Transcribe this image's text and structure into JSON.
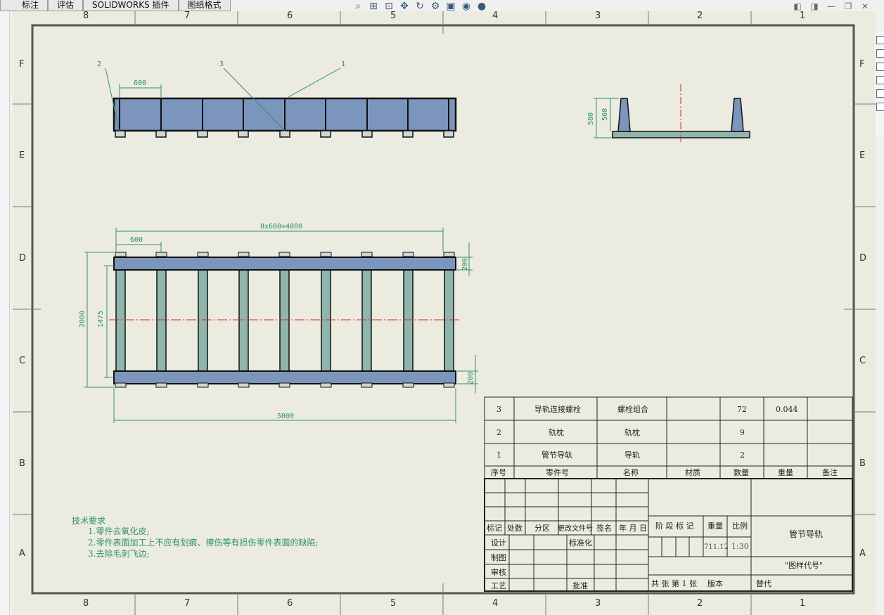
{
  "tabs": [
    "标注",
    "评估",
    "SOLIDWORKS 插件",
    "图纸格式"
  ],
  "zones": {
    "columns": [
      "8",
      "7",
      "6",
      "5",
      "4",
      "3",
      "2",
      "1"
    ],
    "rows": [
      "F",
      "E",
      "D",
      "C",
      "B",
      "A"
    ]
  },
  "dims": {
    "balloon_1": "1",
    "balloon_2": "2",
    "balloon_3": "3",
    "front_pitch": "600",
    "side_580": "580",
    "side_560": "560",
    "top_span": "8x600=4800",
    "top_pitch": "600",
    "overall_2000": "2000",
    "inner_1475": "1475",
    "rail_200_a": "200",
    "rail_200_b": "200",
    "overall_5000": "5000"
  },
  "notes": {
    "title": "技术要求",
    "items": [
      "1.零件去氧化皮;",
      "2.零件表面加工上不应有划痕、擦伤等有损伤零件表面的缺陷;",
      "3.去除毛刺飞边;"
    ]
  },
  "bom": {
    "rows": [
      {
        "seq": "3",
        "part_no": "导轨连接螺栓",
        "name": "螺栓组合",
        "material": "",
        "qty": "72",
        "weight": "0.044",
        "remark": ""
      },
      {
        "seq": "2",
        "part_no": "轨枕",
        "name": "轨枕",
        "material": "",
        "qty": "9",
        "weight": "",
        "remark": ""
      },
      {
        "seq": "1",
        "part_no": "管节导轨",
        "name": "导轨",
        "material": "",
        "qty": "2",
        "weight": "",
        "remark": ""
      }
    ],
    "headers": [
      "序号",
      "零件号",
      "名称",
      "材质",
      "数量",
      "重量",
      "备注"
    ]
  },
  "titleblock": {
    "headers": [
      "标记",
      "处数",
      "分区",
      "更改文件号",
      "签名",
      "年 月 日"
    ],
    "stage_label": "阶 段 标 记",
    "weight_label": "重量",
    "scale_label": "比例",
    "weight_value": "711.12",
    "scale_value": "1:30",
    "design": "设计",
    "standardize": "标准化",
    "drawn": "制图",
    "check": "审核",
    "process": "工艺",
    "approve": "批准",
    "sheets": "共  张  第 1 张",
    "version": "版本",
    "replace": "替代",
    "drawing_name": "管节导轨",
    "drawing_code": "\"图样代号\""
  }
}
